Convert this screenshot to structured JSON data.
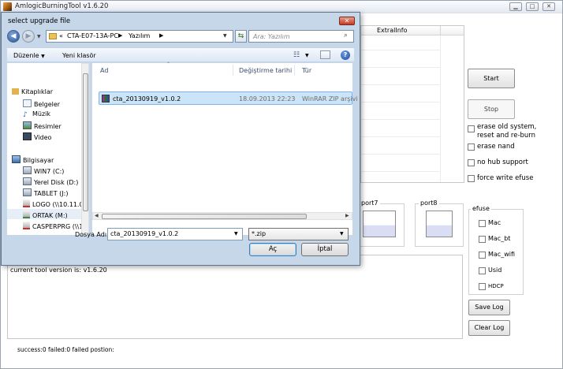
{
  "app": {
    "title": "AmlogicBurningTool  v1.6.20",
    "caption_buttons": [
      "minimize",
      "maximize",
      "close"
    ]
  },
  "table": {
    "columns": [
      "ExtralInfo"
    ]
  },
  "buttons": {
    "start": "Start",
    "stop": "Stop",
    "save_log": "Save Log",
    "clear_log": "Clear Log"
  },
  "options": [
    {
      "label": "erase old system, reset and re-burn",
      "line1": "erase old system,",
      "line2": "reset and re-burn",
      "checked": false
    },
    {
      "label": "erase nand",
      "checked": false
    },
    {
      "label": "no hub support",
      "checked": false
    },
    {
      "label": "force write efuse",
      "checked": false
    }
  ],
  "ports": [
    "port7",
    "port8"
  ],
  "efuse": {
    "title": "efuse",
    "items": [
      "Mac",
      "Mac_bt",
      "Mac_wifi",
      "Usid",
      "HDCP"
    ]
  },
  "log": {
    "version_text": "current tool version is: v1.6.20",
    "status_text": "success:0 failed:0 failed postion:"
  },
  "dialog": {
    "title": "select upgrade file",
    "breadcrumb": [
      "«",
      "CTA-E07-13A-PC",
      "Yazılım"
    ],
    "search_placeholder": "Ara: Yazılım",
    "toolbar": {
      "organize": "Düzenle",
      "new_folder": "Yeni klasör"
    },
    "nav": {
      "libraries": "Kitaplıklar",
      "library_items": [
        "Belgeler",
        "Müzik",
        "Resimler",
        "Video"
      ],
      "computer": "Bilgisayar",
      "drives": [
        "WIN7 (C:)",
        "Yerel Disk (D:)",
        "TABLET (J:)",
        "LOGO (\\\\10.11.0.",
        "ORTAK (M:)",
        "CASPERPRG (\\\\1("
      ]
    },
    "columns": {
      "name": "Ad",
      "modified": "Değiştirme tarihi",
      "type": "Tür"
    },
    "files": [
      {
        "name": "cta_20130919_v1.0.2",
        "modified": "18.09.2013 22:23",
        "type": "WinRAR ZIP arşivi",
        "selected": true
      }
    ],
    "filename_label": "Dosya Adı:",
    "filename_value": "cta_20130919_v1.0.2",
    "filter_value": "*.zip",
    "open_button": "Aç",
    "cancel_button": "İptal"
  },
  "colors": {
    "selection": "#cce4f7",
    "title_gradient_top": "#fafbfd",
    "dialog_frame": "#c6d7ea"
  }
}
